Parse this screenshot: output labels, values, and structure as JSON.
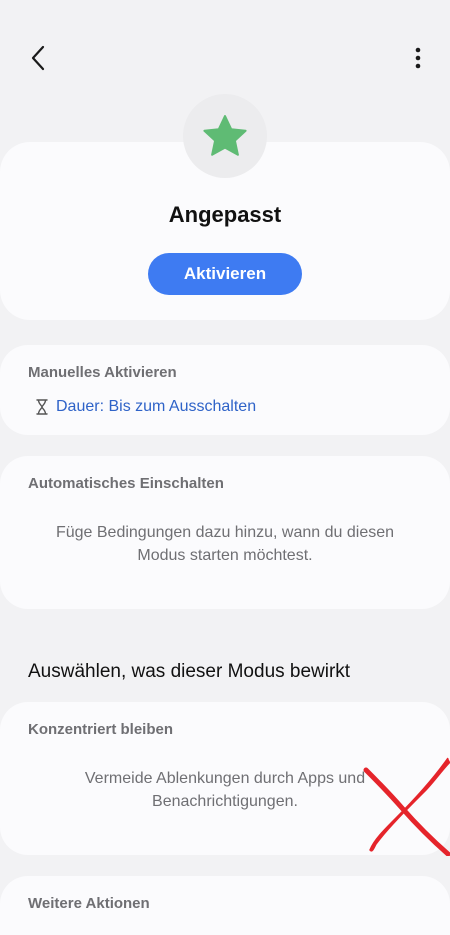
{
  "header": {
    "back_icon": "chevron-left-icon",
    "menu_icon": "more-vertical-icon"
  },
  "mode": {
    "icon": "star-icon",
    "icon_color": "#5fbb74",
    "title": "Angepasst",
    "activate_label": "Aktivieren",
    "accent_color": "#3e7bf2"
  },
  "manual": {
    "title": "Manuelles Aktivieren",
    "duration_icon": "hourglass-icon",
    "duration_text": "Dauer: Bis zum Ausschalten"
  },
  "automatic": {
    "title": "Automatisches Einschalten",
    "description": "Füge Bedingungen dazu hinzu, wann du diesen Modus starten möchtest."
  },
  "effects_heading": "Auswählen, was dieser Modus bewirkt",
  "focus": {
    "title": "Konzentriert bleiben",
    "description": "Vermeide Ablenkungen durch Apps und Benachrichtigungen."
  },
  "more_actions": {
    "title": "Weitere Aktionen"
  }
}
